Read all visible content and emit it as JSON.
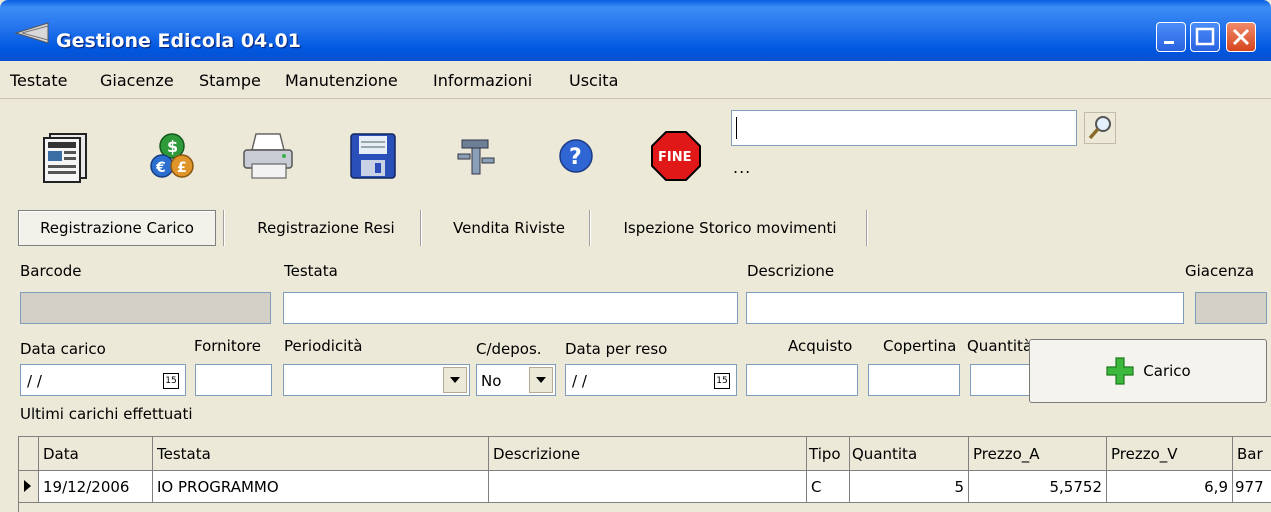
{
  "window": {
    "title": "Gestione Edicola 04.01"
  },
  "menu": [
    "Testate",
    "Giacenze",
    "Stampe",
    "Manutenzione",
    "Informazioni",
    "Uscita"
  ],
  "toolbar": {
    "icons": [
      "newspaper-icon",
      "currency-icon",
      "printer-icon",
      "floppy-save-icon",
      "tools-icon",
      "help-icon",
      "stop-fine-icon"
    ],
    "stop_label": "FINE",
    "search_value": "",
    "status": "..."
  },
  "tabs": [
    "Registrazione Carico",
    "Registrazione Resi",
    "Vendita Riviste",
    "Ispezione Storico movimenti"
  ],
  "form": {
    "barcode_label": "Barcode",
    "testata_label": "Testata",
    "descrizione_label": "Descrizione",
    "giacenza_label": "Giacenza",
    "data_carico_label": "Data carico",
    "data_carico_value": "/ /",
    "fornitore_label": "Fornitore",
    "periodicita_label": "Periodicità",
    "cdepos_label": "C/depos.",
    "cdepos_value": "No",
    "data_reso_label": "Data per reso",
    "data_reso_value": "/ /",
    "acquisto_label": "Acquisto",
    "copertina_label": "Copertina",
    "quantita_label": "Quantità",
    "calendar_glyph": "15",
    "carico_button": "Carico"
  },
  "recent_label": "Ultimi carichi effettuati",
  "table": {
    "columns": [
      "Data",
      "Testata",
      "Descrizione",
      "Tipo",
      "Quantita",
      "Prezzo_A",
      "Prezzo_V",
      "Bar"
    ],
    "rows": [
      [
        "19/12/2006",
        "IO PROGRAMMO",
        "",
        "C",
        "5",
        "5,5752",
        "6,9",
        "977"
      ]
    ]
  }
}
